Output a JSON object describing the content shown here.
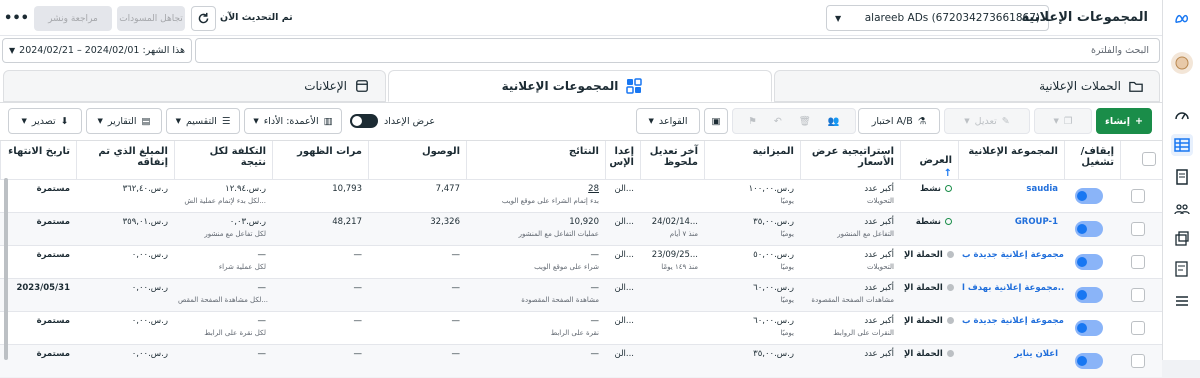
{
  "header": {
    "title": "المجموعات الإعلانية",
    "account": "alareeb ADs (672034273661867)",
    "update_status": "تم التحديث الآن",
    "discard_label": "تجاهل المسودات",
    "review_label": "مراجعة ونشر"
  },
  "search": {
    "placeholder": "البحث والفلترة"
  },
  "daterange": {
    "label": "هذا الشهر: 2024/02/01 – 2024/02/21"
  },
  "tabs": [
    {
      "label": "الحملات الإعلانية"
    },
    {
      "label": "المجموعات الإعلانية"
    },
    {
      "label": "الإعلانات"
    }
  ],
  "toolbar": {
    "create": "إنشاء",
    "edit": "تعديل",
    "abtest": "اختبار A/B",
    "rules": "القواعد",
    "view_setup": "عرض الإعداد",
    "columns": "الأعمدة: الأداء",
    "breakdown": "التقسيم",
    "reports": "التقارير",
    "export": "تصدير"
  },
  "columns": {
    "onoff": "إيقاف/ تشغيل",
    "adset": "المجموعة الإعلانية",
    "delivery": "العرض",
    "bid": "استراتيجية عرض الأسعار",
    "budget": "الميزانية",
    "lastedit": "آخر تعديل ملحوظ",
    "attr": "إعدا الإس",
    "results": "النتائج",
    "reach": "الوصول",
    "impressions": "مرات الظهور",
    "cpr": "التكلفة لكل نتيجة",
    "spent": "المبلغ الذي تم إنفاقه",
    "ends": "تاريخ الانتهاء"
  },
  "rows": [
    {
      "name": "saudia",
      "delivery": "نشط",
      "bid": "أكبر عدد",
      "bid_sub": "التحويلات",
      "budget": "ر.س.١٠٠,٠٠",
      "budget_sub": "يوميًا",
      "lastedit": "",
      "lastedit_sub": "",
      "attr": "الن...",
      "results": "28",
      "results_sub": "بدء إتمام الشراء على موقع الويب",
      "reach": "7,477",
      "impressions": "10,793",
      "cpr": "ر.س.١٢.٩٤",
      "cpr_sub": "لكل بدء لإتمام عملية الش...",
      "spent": "ر.س.٣٦٢,٤٠",
      "ends": "مستمرة"
    },
    {
      "name": "GROUP-1",
      "delivery": "نشطة",
      "bid": "أكبر عدد",
      "bid_sub": "التفاعل مع المنشور",
      "budget": "ر.س.٣٥,٠٠",
      "budget_sub": "يوميًا",
      "lastedit": "24/02/14...",
      "lastedit_sub": "منذ ٧ أيام",
      "attr": "الن...",
      "results": "10,920",
      "results_sub": "عمليات التفاعل مع المنشور",
      "reach": "32,326",
      "impressions": "48,217",
      "cpr": "ر.س.٠,٠٣",
      "cpr_sub": "لكل تفاعل مع منشور",
      "spent": "ر.س.٣٥٩,٠١",
      "ends": "مستمرة"
    },
    {
      "name": "مجموعة إعلانية جديدة ب...",
      "delivery": "الحملة الإ",
      "bid": "أكبر عدد",
      "bid_sub": "التحويلات",
      "budget": "ر.س.٥٠,٠٠",
      "budget_sub": "يوميًا",
      "lastedit": "23/09/25...",
      "lastedit_sub": "منذ ١٤٩ يومًا",
      "attr": "الن...",
      "results": "—",
      "results_sub": "شراء على موقع الويب",
      "reach": "—",
      "impressions": "—",
      "cpr": "—",
      "cpr_sub": "لكل عملية شراء",
      "spent": "ر.س.٠,٠٠",
      "ends": "مستمرة"
    },
    {
      "name": "مجموعة إعلانية بهدف ا...",
      "delivery": "الحملة الإ",
      "bid": "أكبر عدد",
      "bid_sub": "مشاهدات الصفحة المقصودة",
      "budget": "ر.س.٦٠,٠٠",
      "budget_sub": "يوميًا",
      "lastedit": "",
      "lastedit_sub": "",
      "attr": "الن...",
      "results": "—",
      "results_sub": "مشاهدة الصفحة المقصودة",
      "reach": "—",
      "impressions": "—",
      "cpr": "—",
      "cpr_sub": "لكل مشاهدة الصفحة المقص...",
      "spent": "ر.س.٠,٠٠",
      "ends": "2023/05/31"
    },
    {
      "name": "مجموعة إعلانية جديدة ب...",
      "delivery": "الحملة الإ",
      "bid": "أكبر عدد",
      "bid_sub": "النقرات على الروابط",
      "budget": "ر.س.٦٠,٠٠",
      "budget_sub": "يوميًا",
      "lastedit": "",
      "lastedit_sub": "",
      "attr": "الن...",
      "results": "—",
      "results_sub": "نقرة على الرابط",
      "reach": "—",
      "impressions": "—",
      "cpr": "—",
      "cpr_sub": "لكل نقرة على الرابط",
      "spent": "ر.س.٠,٠٠",
      "ends": "مستمرة"
    },
    {
      "name": "اعلان يناير",
      "delivery": "الحملة الإ",
      "bid": "أكبر عدد",
      "bid_sub": "",
      "budget": "ر.س.٣٥,٠٠",
      "budget_sub": "",
      "lastedit": "",
      "lastedit_sub": "",
      "attr": "الن...",
      "results": "—",
      "results_sub": "",
      "reach": "—",
      "impressions": "—",
      "cpr": "—",
      "cpr_sub": "",
      "spent": "ر.س.٠,٠٠",
      "ends": "مستمرة"
    }
  ],
  "colors": {
    "accent": "#1877f2",
    "green": "#1a8d49",
    "link": "#216fdb"
  }
}
